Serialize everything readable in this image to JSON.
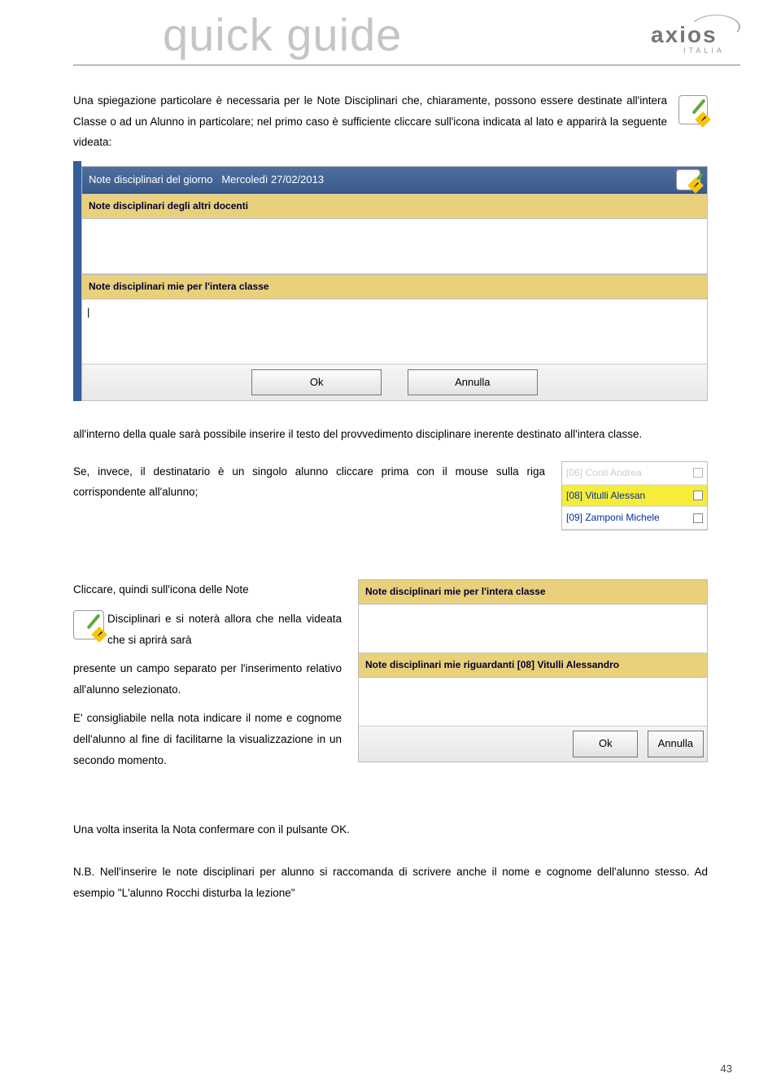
{
  "header": {
    "title": "quick guide",
    "brand": "axios",
    "brand_sub": "ITALIA"
  },
  "intro": {
    "p1": "Una spiegazione particolare è necessaria per le Note Disciplinari che, chiaramente, possono essere destinate all'intera Classe o ad un Alunno in particolare; nel primo caso è sufficiente cliccare sull'icona indicata al lato e apparirà la seguente videata:"
  },
  "dialog1": {
    "title_prefix": "Note disciplinari del giorno",
    "title_day": "Mercoledì 27/02/2013",
    "section1": "Note disciplinari degli altri docenti",
    "section2": "Note disciplinari mie per l'intera classe",
    "ok": "Ok",
    "cancel": "Annulla"
  },
  "mid": {
    "p2": "all'interno della quale sarà possibile inserire il testo del provvedimento disciplinare inerente destinato all'intera classe.",
    "p3": "Se, invece, il destinatario è un singolo alunno cliccare prima con il mouse sulla riga corrispondente all'alunno;"
  },
  "students": {
    "rows": [
      {
        "label": "[06] Conti Andrea"
      },
      {
        "label": "[08] Vitulli Alessan"
      },
      {
        "label": "[09] Zamponi Michele"
      }
    ]
  },
  "block3": {
    "p4a": "Cliccare, quindi sull'icona delle Note",
    "p4b": "Disciplinari e si noterà allora che nella videata che si aprirà sarà",
    "p4c": "presente un campo separato per l'inserimento relativo all'alunno selezionato.",
    "p4d": "E' consigliabile nella nota indicare il nome e cognome dell'alunno al fine di facilitarne la visualizzazione in un secondo momento."
  },
  "dialog2": {
    "section1": "Note disciplinari mie per l'intera classe",
    "section2": "Note disciplinari mie riguardanti [08] Vitulli Alessandro",
    "ok": "Ok",
    "cancel": "Annulla"
  },
  "footer": {
    "p5": "Una volta inserita la Nota confermare con il pulsante OK.",
    "p6": "N.B. Nell'inserire le note disciplinari per alunno si raccomanda di scrivere anche il nome e cognome dell'alunno stesso. Ad esempio \"L'alunno Rocchi disturba la lezione\""
  },
  "page_number": "43"
}
